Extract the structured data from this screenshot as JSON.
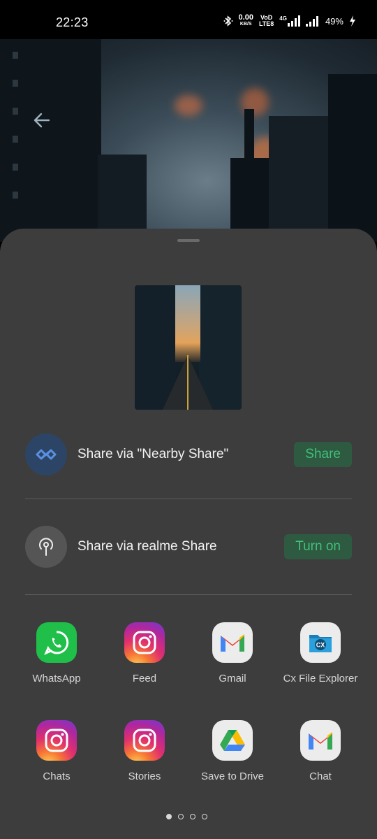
{
  "status_bar": {
    "time": "22:23",
    "net_speed_value": "0.00",
    "net_speed_unit": "KB/S",
    "volte_top": "VoD",
    "volte_bottom": "LTE8",
    "network_type": "4G",
    "battery": "49%",
    "icons": [
      "bluetooth-icon",
      "signal-icon",
      "signal-icon",
      "charging-icon"
    ]
  },
  "wallpaper": {
    "back_icon": "arrow-left-icon"
  },
  "sheet": {
    "nearby": {
      "label": "Share via \"Nearby Share\"",
      "button": "Share",
      "icon": "nearby-share-icon"
    },
    "realme": {
      "label": "Share via realme Share",
      "button": "Turn on",
      "icon": "realme-share-icon"
    },
    "apps": [
      {
        "label": "WhatsApp",
        "icon": "whatsapp-icon"
      },
      {
        "label": "Feed",
        "icon": "instagram-icon"
      },
      {
        "label": "Gmail",
        "icon": "gmail-icon"
      },
      {
        "label": "Cx File Explorer",
        "icon": "cx-file-explorer-icon"
      },
      {
        "label": "Chats",
        "icon": "instagram-icon"
      },
      {
        "label": "Stories",
        "icon": "instagram-icon"
      },
      {
        "label": "Save to Drive",
        "icon": "google-drive-icon"
      },
      {
        "label": "Chat",
        "icon": "gmail-icon"
      }
    ],
    "page_indicator": {
      "pages": 4,
      "current": 1
    }
  },
  "colors": {
    "sheet_bg": "#3d3d3d",
    "accent_green": "#43c07a",
    "button_bg": "#2d5a41"
  }
}
